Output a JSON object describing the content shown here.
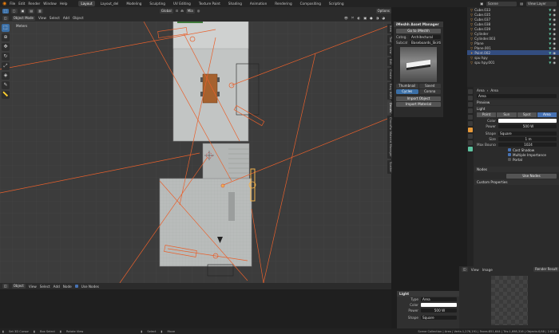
{
  "topbar": {
    "menus": [
      "File",
      "Edit",
      "Render",
      "Window",
      "Help"
    ],
    "workspaces": [
      "Layout",
      "Layout_del",
      "Modeling",
      "Sculpting",
      "UV Editing",
      "Texture Paint",
      "Shading",
      "Animation",
      "Rendering",
      "Compositing",
      "Scripting"
    ],
    "active_workspace": "Layout",
    "scene_label": "Scene",
    "view_layer_label": "View Layer"
  },
  "tool_header": {
    "transform_orientation": "Global",
    "snap_label": "Mia",
    "options_label": "Options"
  },
  "viewport_header": {
    "mode": "Object Mode",
    "menus": [
      "View",
      "Select",
      "Add",
      "Object"
    ],
    "overlay_text": "Meters"
  },
  "toolbar": {
    "tools": [
      "select-box",
      "cursor",
      "move",
      "rotate",
      "scale",
      "transform",
      "annotate",
      "measure"
    ]
  },
  "sidebar_tabs": [
    "Item",
    "Tool",
    "View",
    "Edit",
    "Create",
    "Easy HDRI",
    "Decals",
    "ChocoFur Material Manager",
    "Scatter"
  ],
  "mam_panel": {
    "title": "iMeshh Asset Manager",
    "goto_button": "Go to iMeshh",
    "category_label": "Categ...",
    "category_value": "Architectural",
    "subcategory_label": "Subcat...",
    "subcategory_value": "Baseboards_Skirting",
    "thumbnail_button": "Thumbnail",
    "saved_button": "Saved",
    "cycles_button": "Cycles",
    "corona_button": "Corona",
    "import_object": "Import Object",
    "import_material": "Import Material"
  },
  "outliner": {
    "items": [
      {
        "name": "Cube.033",
        "type": "mesh",
        "selected": false
      },
      {
        "name": "Cube.035",
        "type": "mesh",
        "selected": false
      },
      {
        "name": "Cube.037",
        "type": "mesh",
        "selected": false
      },
      {
        "name": "Cube.038",
        "type": "mesh",
        "selected": false
      },
      {
        "name": "Cube.039",
        "type": "mesh",
        "selected": false
      },
      {
        "name": "Cylinder",
        "type": "mesh",
        "selected": false
      },
      {
        "name": "Cylinder.003",
        "type": "mesh",
        "selected": false
      },
      {
        "name": "Plane",
        "type": "mesh",
        "selected": false
      },
      {
        "name": "Plane.001",
        "type": "mesh",
        "selected": false
      },
      {
        "name": "Point.002",
        "type": "light",
        "selected": true
      },
      {
        "name": "spu hpy",
        "type": "mesh",
        "selected": false
      },
      {
        "name": "spu hpy.001",
        "type": "mesh",
        "selected": false
      }
    ]
  },
  "properties": {
    "breadcrumb_obj": "Area",
    "breadcrumb_data": "Area",
    "datablock": "Area",
    "preview_label": "Preview",
    "light_label": "Light",
    "light_types": [
      "Point",
      "Sun",
      "Spot",
      "Area"
    ],
    "active_light_type": "Area",
    "color_label": "Color",
    "power_label": "Power",
    "power_value": "500 W",
    "shape_label": "Shape",
    "shape_value": "Square",
    "size_label": "Size",
    "size_value": "1 m",
    "max_bounces_label": "Max Bounces",
    "max_bounces_value": "1024",
    "cast_shadow": "Cast Shadow",
    "multiple_importance": "Multiple Importance",
    "portal": "Portal",
    "nodes_label": "Nodes",
    "use_nodes": "Use Nodes",
    "custom_properties": "Custom Properties"
  },
  "node_editor_header": {
    "object_label": "Object",
    "menus": [
      "View",
      "Select",
      "Add",
      "Node"
    ],
    "use_nodes": "Use Nodes"
  },
  "light_panel": {
    "title": "Light",
    "type_label": "Type",
    "type_value": "Area",
    "color_label": "Color",
    "power_label": "Power",
    "power_value": "500 W",
    "shape_label": "Shape",
    "shape_value": "Square"
  },
  "image_editor_header": {
    "view_label": "View",
    "image_label": "Image",
    "result_label": "Render Result"
  },
  "statusbar": {
    "items": [
      "Set 3D Cursor",
      "Box Select",
      "Rotate View",
      "Select",
      "Move"
    ],
    "stats": "Scene Collection | Area | Verts:1,276,191 | Faces:851,644 | Tris:1,698,316 | Objects:0/48 | 2.83.0"
  },
  "colors": {
    "accent": "#4772b3",
    "light_wire": "#e8602c",
    "selection": "#334d80"
  }
}
